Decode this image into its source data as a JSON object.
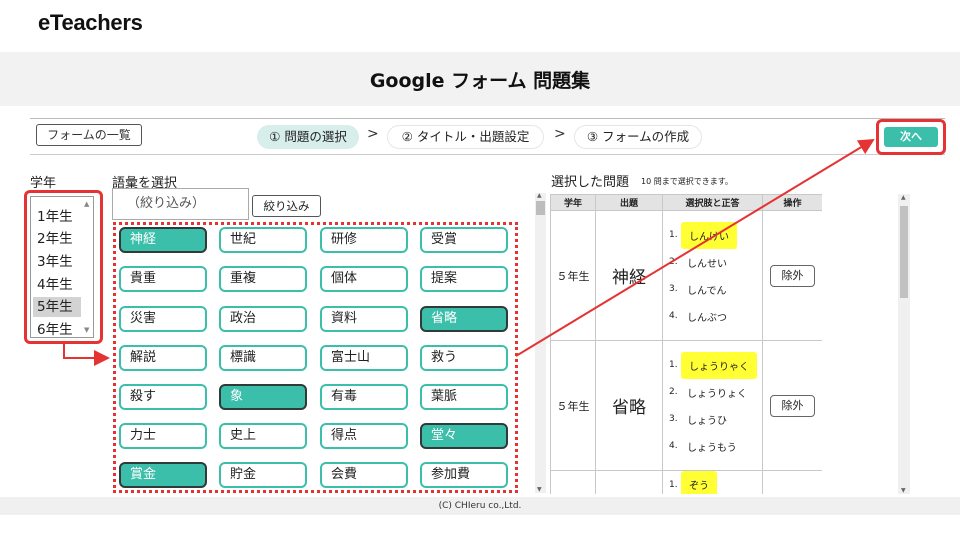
{
  "site": {
    "logo": "eTeachers"
  },
  "banner": {
    "title": "Google フォーム 問題集"
  },
  "toolbar": {
    "form_list_label": "フォームの一覧",
    "steps": [
      {
        "label": "① 問題の選択"
      },
      {
        "label": "② タイトル・出題設定"
      },
      {
        "label": "③ フォームの作成"
      }
    ],
    "arrow_glyph": ">",
    "next_label": "次へ"
  },
  "grade": {
    "label": "学年",
    "items": [
      "1年生",
      "2年生",
      "3年生",
      "4年生",
      "5年生",
      "6年生"
    ],
    "selected": "5年生"
  },
  "vocab": {
    "label": "語彙を選択",
    "filter_placeholder": "（絞り込み）",
    "filter_button": "絞り込み",
    "words": [
      [
        "神経",
        "世紀",
        "研修",
        "受賞"
      ],
      [
        "貴重",
        "重複",
        "個体",
        "提案"
      ],
      [
        "災害",
        "政治",
        "資料",
        "省略"
      ],
      [
        "解説",
        "標識",
        "富士山",
        "救う"
      ],
      [
        "殺す",
        "象",
        "有毒",
        "葉脈"
      ],
      [
        "力士",
        "史上",
        "得点",
        "堂々"
      ],
      [
        "賞金",
        "貯金",
        "会費",
        "参加費"
      ]
    ],
    "selected": [
      "神経",
      "省略",
      "象",
      "堂々",
      "賞金"
    ]
  },
  "selected_questions": {
    "label": "選択した問題",
    "note": "10 問まで選択できます。",
    "headers": [
      "学年",
      "出題",
      "選択肢と正答",
      "操作"
    ],
    "rows": [
      {
        "grade": "５年生",
        "word": "神経",
        "choices": [
          "しんけい",
          "しんせい",
          "しんでん",
          "しんぶつ"
        ],
        "correct": 0,
        "action": "除外"
      },
      {
        "grade": "５年生",
        "word": "省略",
        "choices": [
          "しょうりゃく",
          "しょうりょく",
          "しょうひ",
          "しょうもう"
        ],
        "correct": 0,
        "action": "除外"
      },
      {
        "grade": "",
        "word": "",
        "choices": [
          "ぞう"
        ],
        "correct": 0,
        "action": ""
      }
    ]
  },
  "colors": {
    "accent": "#3cbfaa",
    "highlight": "#e53333",
    "answer": "#ffff33"
  },
  "footer": {
    "copyright": "(C) CHIeru co.,Ltd."
  }
}
